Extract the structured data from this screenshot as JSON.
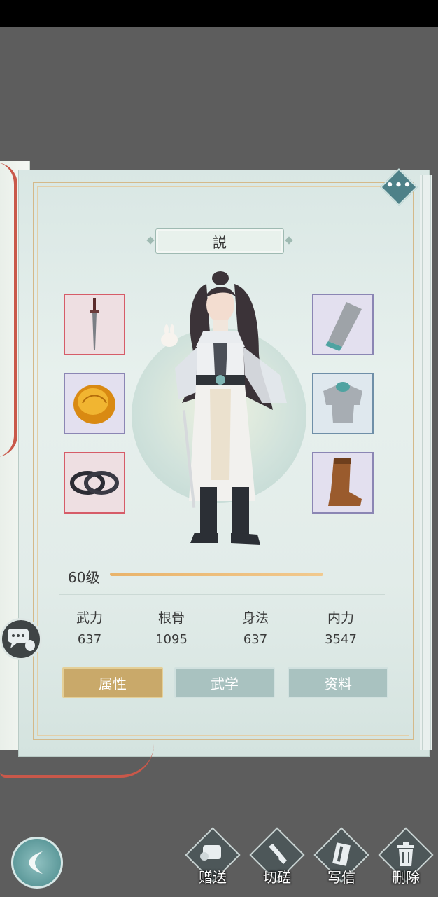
{
  "character": {
    "name": "説",
    "level": "60级"
  },
  "equipment": {
    "left": [
      {
        "name": "dagger",
        "color": "red"
      },
      {
        "name": "amber-gem",
        "color": "violet"
      },
      {
        "name": "bracelets",
        "color": "red"
      }
    ],
    "right": [
      {
        "name": "bracer",
        "color": "violet"
      },
      {
        "name": "chest-armor",
        "color": "blue"
      },
      {
        "name": "boot",
        "color": "violet"
      }
    ]
  },
  "stats": [
    {
      "label": "武力",
      "value": "637"
    },
    {
      "label": "根骨",
      "value": "1095"
    },
    {
      "label": "身法",
      "value": "637"
    },
    {
      "label": "内力",
      "value": "3547"
    }
  ],
  "tabs": [
    {
      "label": "属性",
      "active": true
    },
    {
      "label": "武学",
      "active": false
    },
    {
      "label": "资料",
      "active": false
    }
  ],
  "actions": [
    {
      "label": "赠送",
      "icon": "scroll-icon"
    },
    {
      "label": "切磋",
      "icon": "sword-icon"
    },
    {
      "label": "写信",
      "icon": "letter-icon"
    },
    {
      "label": "删除",
      "icon": "trash-icon"
    }
  ],
  "colors": {
    "active_tab": "#c9a96a",
    "idle_tab": "#a9c2c0",
    "slot_red_border": "#d65c68",
    "slot_violet_border": "#8b86b4",
    "level_bar": "#e9b36a"
  }
}
